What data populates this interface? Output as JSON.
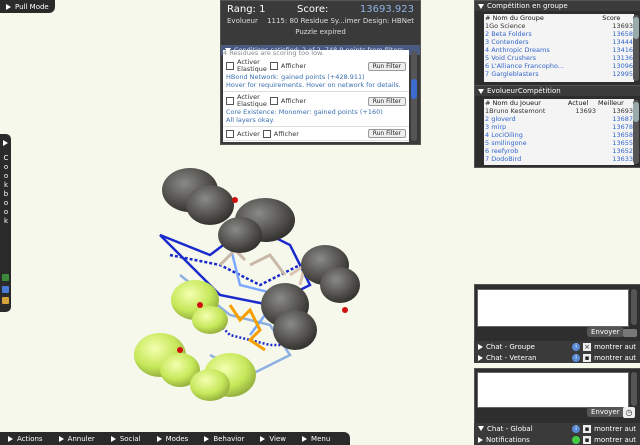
{
  "top_left": {
    "label": "Pull Mode"
  },
  "score_panel": {
    "rank_label": "Rang: 1",
    "score_label": "Score:",
    "score_value": "13693.923",
    "player": "Evolueur",
    "puzzle": "1115: 80 Residue Sy...imer Design: HBNet",
    "status": "Puzzle expired",
    "conditions_header": "Conditions satisfied: 2 of 2, 748.9 points from filters",
    "cond_overflow": "4 Residues are scoring too low.",
    "items": [
      {
        "check1": "Activer",
        "check1b": "Elastique",
        "show": "Afficher",
        "run": "Run Filter",
        "title": "HBond Network: gained points (+428.911)",
        "desc": "Hover for requirements. Hover on network for details."
      },
      {
        "check1": "Activer",
        "check1b": "Elastique",
        "show": "Afficher",
        "run": "Run Filter",
        "title": "Core Existence: Monomer: gained points (+160)",
        "desc": "All layers okay."
      },
      {
        "check1": "Activer",
        "check1b": "",
        "show": "Afficher",
        "run": "Run Filter",
        "title": "",
        "desc": ""
      }
    ]
  },
  "group_competition": {
    "title": "Compétition en groupe",
    "headers": [
      "# Nom du Groupe",
      "Score"
    ],
    "rows": [
      [
        "1Go Science",
        "13693"
      ],
      [
        "2 Beta Folders",
        "13658"
      ],
      [
        "3 Contenders",
        "13444"
      ],
      [
        "4 Anthropic Dreams",
        "13416"
      ],
      [
        "5 Void Crushers",
        "13136"
      ],
      [
        "6 L'Alliance Francopho...",
        "13096"
      ],
      [
        "7 Gargleblasters",
        "12995"
      ]
    ]
  },
  "evolver_competition": {
    "title": "EvolueurCompétition",
    "headers": [
      "# Nom du Joueur",
      "Actuel",
      "Meilleur"
    ],
    "rows": [
      [
        "1Bruno Kestemont",
        "13693",
        "13693"
      ],
      [
        "2 gloverd",
        "",
        "13687"
      ],
      [
        "3 mirp",
        "",
        "13678"
      ],
      [
        "4 LociOiling",
        "",
        "13658"
      ],
      [
        "5 smilingone",
        "",
        "13655"
      ],
      [
        "6 reefyrob",
        "",
        "13652"
      ],
      [
        "7 DodoBird",
        "",
        "13633"
      ]
    ]
  },
  "chat": {
    "send_label": "Envoyer",
    "rows": [
      {
        "label": "Chat - Groupe",
        "show": "montrer aut"
      },
      {
        "label": "Chat - Veteran",
        "show": "montrer aut"
      },
      {
        "label": "Chat - Global",
        "show": "montrer aut"
      },
      {
        "label": "Notifications",
        "show": "montrer aut"
      }
    ]
  },
  "bottom_menu": [
    "Actions",
    "Annuler",
    "Social",
    "Modes",
    "Behavior",
    "View",
    "Menu"
  ],
  "cookbook": {
    "letters": [
      "C",
      "o",
      "o",
      "k",
      "b",
      "o",
      "o",
      "k"
    ]
  }
}
